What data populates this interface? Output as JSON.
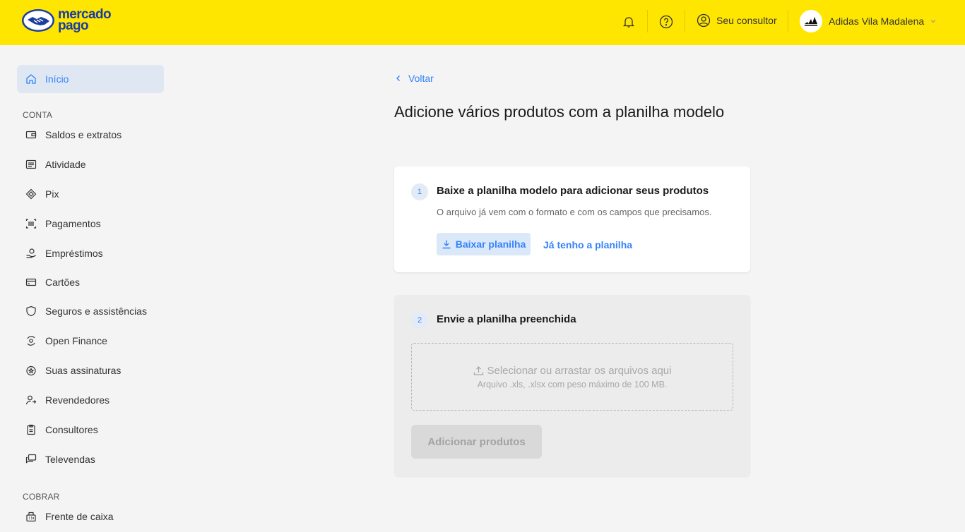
{
  "brand": {
    "line1": "mercado",
    "line2": "pago",
    "primary": "#ffe600",
    "accent": "#3483fa"
  },
  "header": {
    "notifications_icon": "bell-icon",
    "help_icon": "question-circle-icon",
    "consultor_label": "Seu consultor",
    "account_name": "Adidas Vila Madalena"
  },
  "sidebar": {
    "home": {
      "label": "Início",
      "icon": "home-icon"
    },
    "section_conta": "CONTA",
    "items": [
      {
        "label": "Saldos e extratos",
        "icon": "wallet-icon"
      },
      {
        "label": "Atividade",
        "icon": "list-icon"
      },
      {
        "label": "Pix",
        "icon": "pix-icon"
      },
      {
        "label": "Pagamentos",
        "icon": "barcode-icon"
      },
      {
        "label": "Empréstimos",
        "icon": "loan-icon"
      },
      {
        "label": "Cartões",
        "icon": "card-icon"
      },
      {
        "label": "Seguros e assistências",
        "icon": "shield-icon"
      },
      {
        "label": "Open Finance",
        "icon": "open-finance-icon"
      },
      {
        "label": "Suas assinaturas",
        "icon": "subscription-icon"
      },
      {
        "label": "Revendedores",
        "icon": "resellers-icon"
      },
      {
        "label": "Consultores",
        "icon": "clipboard-icon"
      },
      {
        "label": "Televendas",
        "icon": "chat-icon"
      }
    ],
    "section_cobrar": "COBRAR",
    "cobrar_items": [
      {
        "label": "Frente de caixa",
        "icon": "register-icon"
      }
    ]
  },
  "main": {
    "back_label": "Voltar",
    "title": "Adicione vários produtos com a planilha modelo",
    "step1": {
      "number": "1",
      "title": "Baixe a planilha modelo para adicionar seus produtos",
      "description": "O arquivo já vem com o formato e com os campos que precisamos.",
      "download_label": "Baixar planilha",
      "have_label": "Já tenho a planilha"
    },
    "step2": {
      "number": "2",
      "title": "Envie a planilha preenchida",
      "dropzone_main": "Selecionar ou arrastar os arquivos aqui",
      "dropzone_sub": "Arquivo .xls, .xlsx com peso máximo de 100 MB.",
      "submit_label": "Adicionar produtos"
    }
  }
}
